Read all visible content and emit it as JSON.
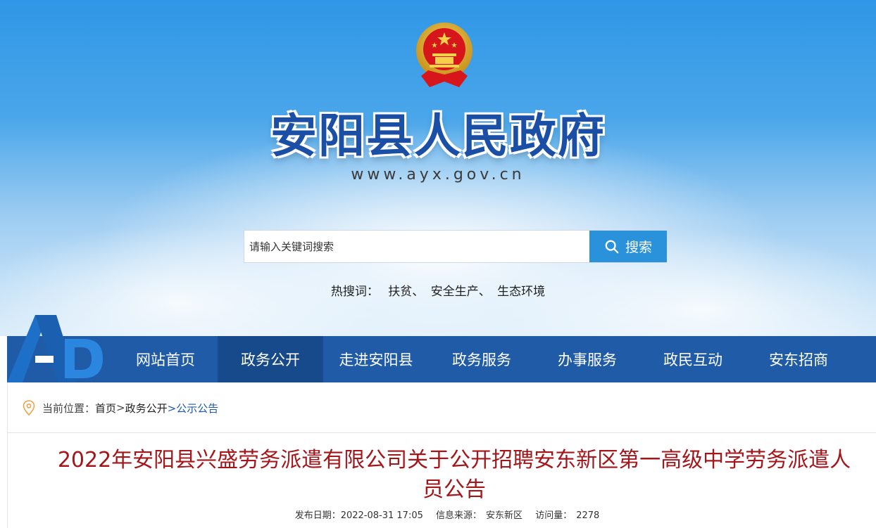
{
  "header": {
    "site_title": "安阳县人民政府",
    "site_url": "www.ayx.gov.cn"
  },
  "search": {
    "placeholder": "请输入关键词搜索",
    "button_label": "搜索",
    "hot_label": "热搜词：",
    "hot_words": [
      "扶贫、",
      "安全生产、",
      "生态环境"
    ]
  },
  "logo": {
    "letters": "AD"
  },
  "nav": {
    "items": [
      {
        "label": "网站首页"
      },
      {
        "label": "政务公开"
      },
      {
        "label": "走进安阳县"
      },
      {
        "label": "政务服务"
      },
      {
        "label": "办事服务"
      },
      {
        "label": "政民互动"
      },
      {
        "label": "安东招商"
      }
    ],
    "active_index": 1
  },
  "breadcrumb": {
    "label": "当前位置：",
    "home": "首页",
    "sep1": ">",
    "section": "政务公开",
    "current": ">公示公告"
  },
  "article": {
    "title": "2022年安阳县兴盛劳务派遣有限公司关于公开招聘安东新区第一高级中学劳务派遣人员公告",
    "date_label": "发布日期：",
    "date": "2022-08-31 17:05",
    "source_label": "信息来源：",
    "source": "安东新区",
    "views_label": "访问量：",
    "views": "2278"
  },
  "colors": {
    "nav_bg": "#1f5ba6",
    "nav_active": "#174a8a",
    "title_red": "#a4161a",
    "search_button": "#2a91db"
  }
}
